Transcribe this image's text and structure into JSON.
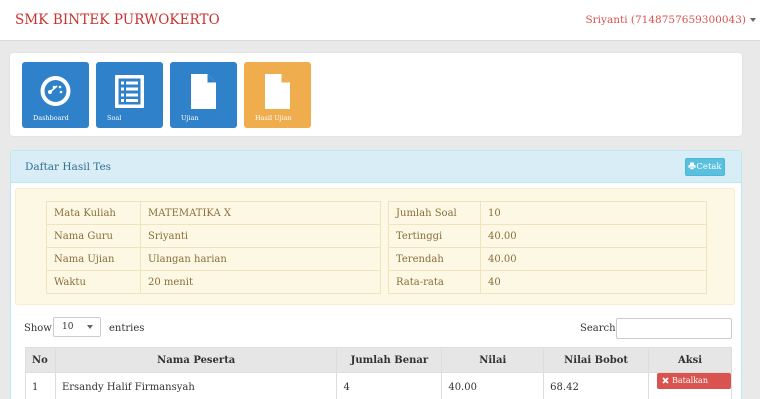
{
  "header": {
    "brand": "SMK BINTEK PURWOKERTO",
    "user": "Sriyanti (7148757659300043)"
  },
  "tiles": [
    {
      "label": "Dashboard",
      "icon": "dashboard-icon",
      "color": "#2f82c9"
    },
    {
      "label": "Soal",
      "icon": "list-icon",
      "color": "#2f82c9"
    },
    {
      "label": "Ujian",
      "icon": "file-icon",
      "color": "#2f82c9"
    },
    {
      "label": "Hasil Ujian",
      "icon": "file-icon",
      "color": "#f0ad4e"
    }
  ],
  "panel": {
    "title": "Daftar Hasil Tes",
    "print_label": "Cetak"
  },
  "info_left": [
    {
      "label": "Mata Kuliah",
      "value": "MATEMATIKA X"
    },
    {
      "label": "Nama Guru",
      "value": "Sriyanti"
    },
    {
      "label": "Nama Ujian",
      "value": "Ulangan harian"
    },
    {
      "label": "Waktu",
      "value": "20 menit"
    }
  ],
  "info_right": [
    {
      "label": "Jumlah Soal",
      "value": "10"
    },
    {
      "label": "Tertinggi",
      "value": "40.00"
    },
    {
      "label": "Terendah",
      "value": "40.00"
    },
    {
      "label": "Rata-rata",
      "value": "40"
    }
  ],
  "table_controls": {
    "show_label": "Show",
    "page_size": "10",
    "entries_label": "entries",
    "search_label": "Search:",
    "search_value": ""
  },
  "results": {
    "columns": [
      "No",
      "Nama Peserta",
      "Jumlah Benar",
      "Nilai",
      "Nilai Bobot",
      "Aksi"
    ],
    "rows": [
      {
        "no": "1",
        "name": "Ersandy Halif Firmansyah",
        "correct": "4",
        "score": "40.00",
        "weighted": "68.42",
        "action": "Batalkan Ujian"
      }
    ]
  }
}
